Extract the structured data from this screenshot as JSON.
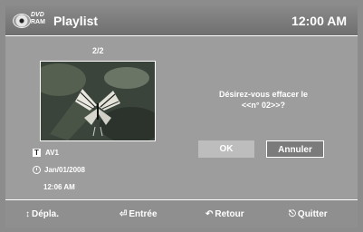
{
  "header": {
    "logo_top": "DVD",
    "logo_bottom": "RAM",
    "title": "Playlist",
    "time": "12:00 AM"
  },
  "thumbnail": {
    "pager": "2/2"
  },
  "info": {
    "source_badge": "T",
    "source": "AV1",
    "date": "Jan/01/2008",
    "time": "12:06 AM"
  },
  "dialog": {
    "line1": "Désirez-vous effacer le",
    "line2": "<<n° 02>>?",
    "ok_label": "OK",
    "cancel_label": "Annuler"
  },
  "footer": {
    "move": "Dépla.",
    "enter": "Entrée",
    "return": "Retour",
    "exit": "Quitter"
  }
}
